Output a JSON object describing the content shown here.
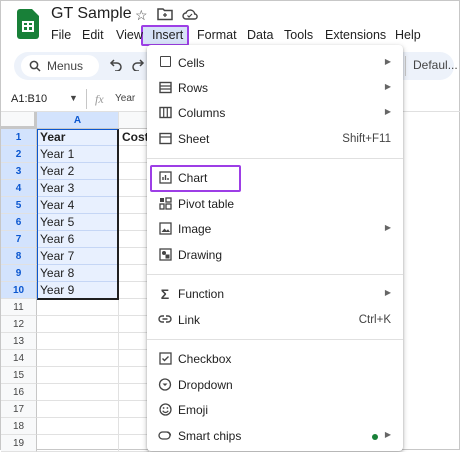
{
  "app": {
    "doc_title": "GT Sample"
  },
  "header_icons": [
    "star-icon",
    "move-to-folder-icon",
    "cloud-status-icon"
  ],
  "menubar": [
    "File",
    "Edit",
    "View",
    "Insert",
    "Format",
    "Data",
    "Tools",
    "Extensions",
    "Help"
  ],
  "active_menu": "Insert",
  "toolbar": {
    "search_label": "Menus",
    "font": "Defaul..."
  },
  "formula_bar": {
    "range": "A1:B10",
    "content": "Year"
  },
  "sheet": {
    "col_a": "A",
    "header_a": "Year",
    "header_b": "Cost",
    "rows": [
      "Year 1",
      "Year 2",
      "Year 3",
      "Year 4",
      "Year 5",
      "Year 6",
      "Year 7",
      "Year 8",
      "Year 9"
    ],
    "row_numbers": [
      "1",
      "2",
      "3",
      "4",
      "5",
      "6",
      "7",
      "8",
      "9",
      "10",
      "11",
      "12",
      "13",
      "14",
      "15",
      "16",
      "17",
      "18",
      "19"
    ]
  },
  "insert_menu": {
    "items": [
      {
        "label": "Cells",
        "icon": "cells-icon",
        "submenu": true
      },
      {
        "label": "Rows",
        "icon": "rows-icon",
        "submenu": true
      },
      {
        "label": "Columns",
        "icon": "columns-icon",
        "submenu": true
      },
      {
        "label": "Sheet",
        "icon": "sheet-icon",
        "shortcut": "Shift+F11"
      },
      {
        "label": "Chart",
        "icon": "chart-icon"
      },
      {
        "label": "Pivot table",
        "icon": "pivot-table-icon"
      },
      {
        "label": "Image",
        "icon": "image-icon",
        "submenu": true
      },
      {
        "label": "Drawing",
        "icon": "drawing-icon"
      },
      {
        "label": "Function",
        "icon": "sigma-icon",
        "submenu": true
      },
      {
        "label": "Link",
        "icon": "link-icon",
        "shortcut": "Ctrl+K"
      },
      {
        "label": "Checkbox",
        "icon": "checkbox-icon"
      },
      {
        "label": "Dropdown",
        "icon": "dropdown-icon"
      },
      {
        "label": "Emoji",
        "icon": "emoji-icon"
      },
      {
        "label": "Smart chips",
        "icon": "smart-chips-icon",
        "submenu": true
      }
    ]
  },
  "colors": {
    "highlight": "#9d3ee6",
    "selection": "#d3e3fd",
    "brand": "#188038"
  }
}
